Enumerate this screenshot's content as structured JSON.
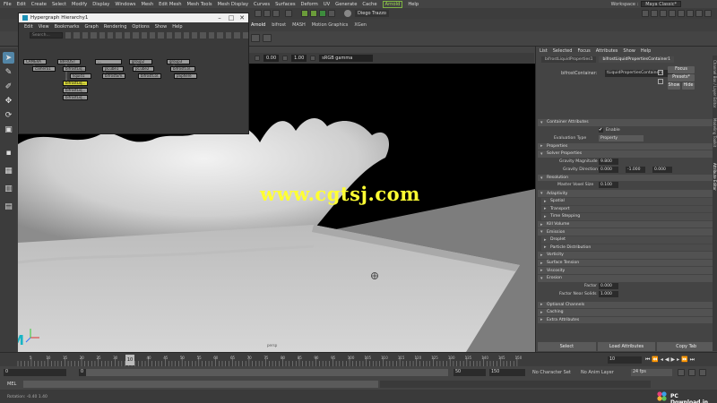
{
  "menubar": {
    "items": [
      "File",
      "Edit",
      "Create",
      "Select",
      "Modify",
      "Display",
      "Windows",
      "Mesh",
      "Edit Mesh",
      "Mesh Tools",
      "Mesh Display",
      "Curves",
      "Surfaces",
      "Deform",
      "UV",
      "Generate",
      "Cache"
    ],
    "highlight": "Arnold",
    "help": "Help",
    "workspace_label": "Workspace :",
    "workspace_value": "Maya Classic*"
  },
  "statusline": {
    "user": "Diego Trazzo"
  },
  "shelf_tabs": [
    "Arnold",
    "bifrost",
    "MASH",
    "Motion Graphics",
    "XGen"
  ],
  "hypergraph": {
    "title": "Hypergraph Hierarchy1",
    "menus": [
      "Edit",
      "View",
      "Bookmarks",
      "Graph",
      "Rendering",
      "Options",
      "Show",
      "Help"
    ],
    "search_placeholder": "Search...",
    "nodes": [
      {
        "label": "CAMERA",
        "type": "gray"
      },
      {
        "label": "BIFROST",
        "type": "gray"
      },
      {
        "label": "...",
        "type": "gray"
      },
      {
        "label": "group2",
        "type": "gray"
      },
      {
        "label": "group3",
        "type": "gray"
      },
      {
        "label": "camera1",
        "type": "gray"
      },
      {
        "label": "bifrostLiq...",
        "type": "gray"
      },
      {
        "label": "pCube1",
        "type": "gray"
      },
      {
        "label": "pCube2",
        "type": "gray"
      },
      {
        "label": "bifrostCol...",
        "type": "gray"
      },
      {
        "label": "liquid1",
        "type": "gray"
      },
      {
        "label": "bifrostEm...",
        "type": "gray"
      },
      {
        "label": "bifrostCol...",
        "type": "gray"
      },
      {
        "label": "pSphere",
        "type": "gray"
      },
      {
        "label": "bifrostLiq...",
        "type": "yellow"
      },
      {
        "label": "bifrostLiq...",
        "type": "gray"
      },
      {
        "label": "bifrostLiq...",
        "type": "gray"
      }
    ]
  },
  "viewport_bar": {
    "val1": "0.00",
    "val2": "1.00",
    "colorspace": "sRGB gamma"
  },
  "viewport": {
    "watermark": "www.cgtsj.com",
    "camera_label": "persp",
    "logo_letter": "M"
  },
  "attribute_editor": {
    "menus": [
      "List",
      "Selected",
      "Focus",
      "Attributes",
      "Show",
      "Help"
    ],
    "tabs": [
      "bifrostLiquidProperties1",
      "bifrostLiquidPropertiesContainer1"
    ],
    "node_label": "bifrostContainer:",
    "node_value": "tLiquidPropertiesContainer1",
    "focus_button": "Focus",
    "presets_button": "Presets*",
    "show_button": "Show",
    "hide_button": "Hide",
    "sections": [
      {
        "label": "Container Attributes",
        "open": true
      },
      {
        "label": "Properties",
        "open": false
      },
      {
        "label": "Solver Properties",
        "open": true
      },
      {
        "label": "Resolution",
        "open": true
      },
      {
        "label": "Adaptivity",
        "open": true
      },
      {
        "label": "Spatial",
        "open": false,
        "sub": true
      },
      {
        "label": "Transport",
        "open": false,
        "sub": true
      },
      {
        "label": "Time Stepping",
        "open": false,
        "sub": true
      },
      {
        "label": "Kill Volume",
        "open": false
      },
      {
        "label": "Emission",
        "open": true
      },
      {
        "label": "Droplet",
        "open": false,
        "sub": true
      },
      {
        "label": "Particle Distribution",
        "open": false,
        "sub": true
      },
      {
        "label": "Vorticity",
        "open": false
      },
      {
        "label": "Surface Tension",
        "open": false
      },
      {
        "label": "Viscosity",
        "open": false
      },
      {
        "label": "Erosion",
        "open": true
      },
      {
        "label": "Optional Channels",
        "open": false
      },
      {
        "label": "Caching",
        "open": false
      },
      {
        "label": "Extra Attributes",
        "open": false
      }
    ],
    "enable_label": "Enable",
    "eval_type_label": "Evaluation Type",
    "eval_type_value": "Property",
    "gravity_magnitude_label": "Gravity Magnitude",
    "gravity_magnitude": "9.800",
    "gravity_direction_label": "Gravity Direction",
    "gravity_direction": [
      "0.000",
      "-1.000",
      "0.000"
    ],
    "master_voxel_label": "Master Voxel Size",
    "master_voxel": "0.100",
    "factor_label": "Factor",
    "factor_value": "0.000",
    "factor_near_label": "Factor Near Solids",
    "factor_near_value": "1.000",
    "bottom_buttons": [
      "Select",
      "Load Attributes",
      "Copy Tab"
    ],
    "side_tabs": [
      "Channel Box / Layer Editor",
      "Modeling Toolkit",
      "Attribute Editor"
    ]
  },
  "timeline": {
    "current_frame": "10",
    "ticks": [
      "5",
      "10",
      "15",
      "20",
      "25",
      "30",
      "35",
      "40",
      "45",
      "50",
      "55",
      "60",
      "65",
      "70",
      "75",
      "80",
      "85",
      "90",
      "95",
      "100",
      "105",
      "110",
      "115",
      "120",
      "125",
      "130",
      "135",
      "140",
      "145",
      "150"
    ],
    "frame_field": "10"
  },
  "range": {
    "start": "0",
    "inner_start": "0",
    "inner_end": "50",
    "end": "50",
    "end2": "150",
    "character_set": "No Character Set",
    "anim_layer": "No Anim Layer",
    "fps": "24 fps"
  },
  "mel": {
    "label": "MEL"
  },
  "help_line": {
    "text": "Rotation: -0.40    1.40"
  },
  "brand": {
    "site": "PC Download.in",
    "accent": "#7db542"
  }
}
